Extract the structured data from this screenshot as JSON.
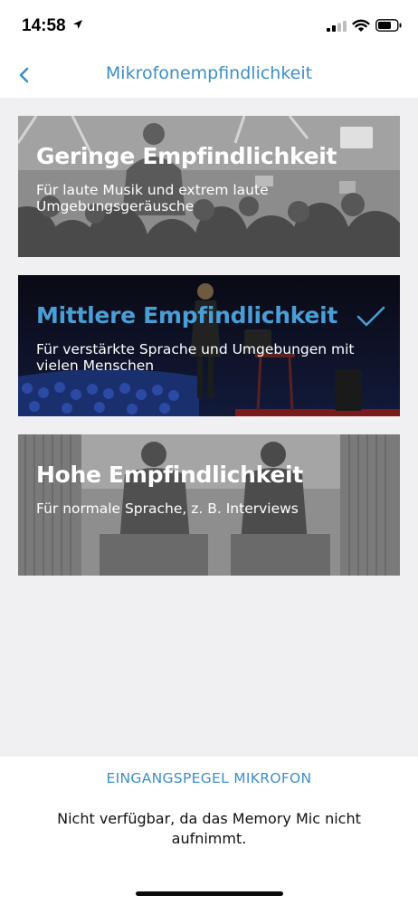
{
  "status_bar": {
    "time": "14:58",
    "icons": [
      "location-arrow-icon",
      "cellular-signal-icon",
      "wifi-icon",
      "battery-icon"
    ]
  },
  "nav": {
    "back_icon": "chevron-left-icon",
    "title": "Mikrofonempfindlichkeit",
    "accent_color": "#3d8fc4"
  },
  "options": [
    {
      "title": "Geringe Empfindlichkeit",
      "description": "Für laute Musik und extrem laute Umgebungsgeräusche",
      "selected": false,
      "image": "concert crowd photo"
    },
    {
      "title": "Mittlere Empfindlichkeit",
      "description": "Für verstärkte Sprache und Umgebungen mit vielen Menschen",
      "selected": true,
      "image": "speaker on stage photo",
      "check_icon": "checkmark-icon"
    },
    {
      "title": "Hohe Empfindlichkeit",
      "description": "Für normale Sprache, z. B. Interviews",
      "selected": false,
      "image": "interview photo"
    }
  ],
  "input_level": {
    "heading": "EINGANGSPEGEL MIKROFON",
    "text": "Nicht verfügbar, da das Memory Mic nicht aufnimmt."
  },
  "colors": {
    "selected_title": "#4a9ed6",
    "selected_card_bg": "#0a0a12",
    "unselected_card_tint": "#8a8a8a"
  }
}
